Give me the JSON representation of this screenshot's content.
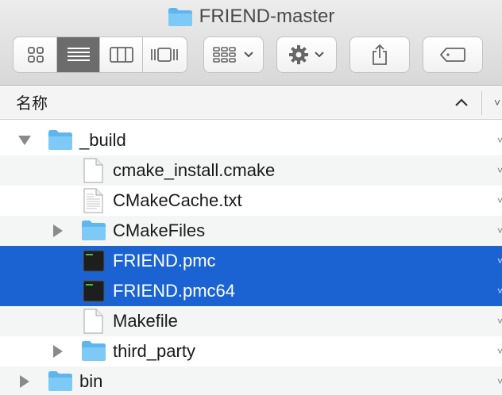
{
  "window": {
    "title": "FRIEND-master"
  },
  "toolbar": {
    "view_icons": "icon-view-icon",
    "view_list": "list-view-icon",
    "view_columns": "column-view-icon",
    "view_gallery": "gallery-view-icon",
    "arrange": "arrange-icon",
    "action": "gear-icon",
    "share": "share-icon",
    "tags": "tag-icon"
  },
  "header": {
    "name_column": "名称"
  },
  "files": [
    {
      "name": "_build",
      "kind": "folder",
      "expanded": true,
      "level": 0,
      "selected": false
    },
    {
      "name": "cmake_install.cmake",
      "kind": "document",
      "level": 1,
      "selected": false
    },
    {
      "name": "CMakeCache.txt",
      "kind": "text",
      "level": 1,
      "selected": false
    },
    {
      "name": "CMakeFiles",
      "kind": "folder",
      "expanded": false,
      "level": 1,
      "selected": false
    },
    {
      "name": "FRIEND.pmc",
      "kind": "executable",
      "level": 1,
      "selected": true
    },
    {
      "name": "FRIEND.pmc64",
      "kind": "executable",
      "level": 1,
      "selected": true
    },
    {
      "name": "Makefile",
      "kind": "document",
      "level": 1,
      "selected": false
    },
    {
      "name": "third_party",
      "kind": "folder",
      "expanded": false,
      "level": 1,
      "selected": false
    },
    {
      "name": "bin",
      "kind": "folder",
      "expanded": false,
      "level": 0,
      "selected": false
    }
  ],
  "colors": {
    "selection": "#1b63d2",
    "folder": "#6cc1f2"
  }
}
